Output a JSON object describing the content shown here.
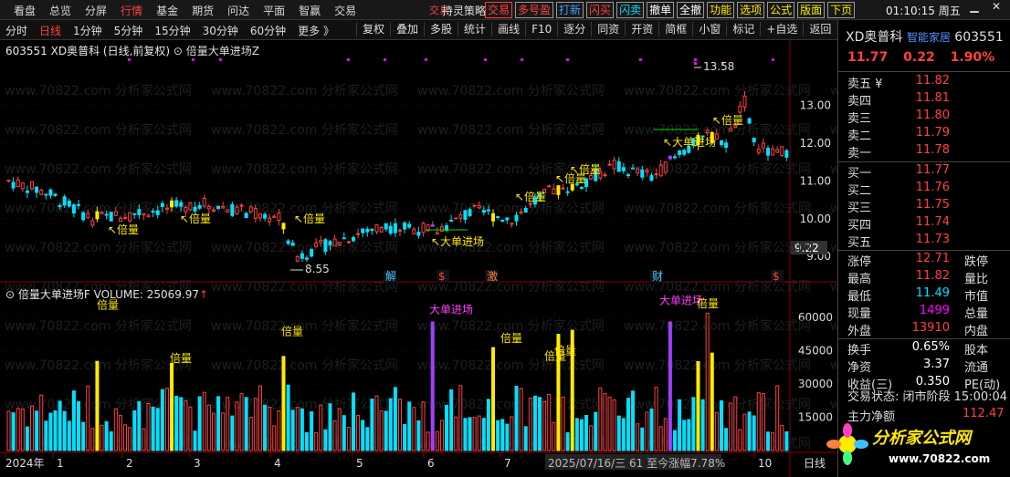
{
  "menu": [
    "看盘",
    "总览",
    "分屏",
    "行情",
    "基金",
    "期货",
    "问达",
    "平面",
    "智赢",
    "交易"
  ],
  "menu_active": "行情",
  "trade_pink": "交易",
  "strategy": "持灵策略",
  "chips": [
    "交易",
    "多号盈",
    "打新",
    "闪买",
    "闪卖",
    "撤单",
    "全撤",
    "功能",
    "选项",
    "公式",
    "版面",
    "下页"
  ],
  "clock": "01:10:15 周五",
  "periods": [
    "分时",
    "日线",
    "1分钟",
    "5分钟",
    "15分钟",
    "30分钟",
    "60分钟",
    "更多 》"
  ],
  "period_selected": "日线",
  "tools": [
    "复权",
    "叠加",
    "多股",
    "统计",
    "画线",
    "F10",
    "逐分",
    "同资",
    "开资",
    "简框",
    "小窗",
    "标记",
    "+自选",
    "返回"
  ],
  "chart_title": "603551 XD奥普科 (日线,前复权)",
  "formula1": "倍量大单进场Z",
  "formula2": "倍量大单进场F",
  "volume_label": "VOLUME: 25069.97",
  "price_axis": [
    "13.00",
    "12.00",
    "11.00",
    "10.00",
    "9.00"
  ],
  "price_current": "9.22",
  "vol_axis": [
    "60000",
    "45000",
    "30000",
    "15000"
  ],
  "months": [
    "2024年",
    "1",
    "2",
    "3",
    "4",
    "5",
    "6",
    "7",
    "9",
    "10"
  ],
  "status_bar": "2025/07/16/三 61 至今涨幅7.78%",
  "last_label": "日线",
  "annotations": {
    "high": "13.58",
    "low": "8.55",
    "double": "倍量",
    "big": "大单进场"
  },
  "event_marks": [
    "解",
    "$",
    "激",
    "财",
    "$"
  ],
  "watermark": "www.70822.com 分析家公式网",
  "quote": {
    "code": "603551",
    "name": "XD奥普科",
    "brand": "智能家居",
    "price": "11.77",
    "change": "0.22",
    "pct": "1.90%",
    "asks": [
      [
        "卖五 ¥",
        "11.82"
      ],
      [
        "卖四",
        "11.81"
      ],
      [
        "卖三",
        "11.80"
      ],
      [
        "卖二",
        "11.79"
      ],
      [
        "卖一",
        "11.78"
      ]
    ],
    "bids": [
      [
        "买一",
        "11.77"
      ],
      [
        "买二",
        "11.76"
      ],
      [
        "买三",
        "11.75"
      ],
      [
        "买四",
        "11.74"
      ],
      [
        "买五",
        "11.73"
      ]
    ],
    "stats": [
      [
        "涨停",
        "12.71",
        "跌停"
      ],
      [
        "最高",
        "11.82",
        "量比"
      ],
      [
        "最低",
        "11.49",
        "市值"
      ],
      [
        "现量",
        "1499",
        "总量"
      ],
      [
        "外盘",
        "13910",
        "内盘"
      ]
    ],
    "stats2": [
      [
        "换手",
        "0.65%",
        "股本"
      ],
      [
        "净资",
        "3.37",
        "流通"
      ],
      [
        "收益(三)",
        "0.350",
        "PE(动)"
      ]
    ],
    "trade_state": "交易状态: 闭市阶段 15:00:04",
    "main_flow": "主力净额",
    "main_flow_val": "112.47"
  },
  "logo": {
    "text": "分析家公式网",
    "url": "www.70822.com"
  },
  "chart_data": {
    "type": "bar",
    "title": "603551 XD奥普科 (日线,前复权)",
    "ylim_price": [
      8.4,
      14.2
    ],
    "ylim_volume": [
      0,
      65000
    ],
    "price_high": 13.58,
    "price_low": 8.55,
    "last_close": 11.77,
    "volume_last": 25069.97
  }
}
